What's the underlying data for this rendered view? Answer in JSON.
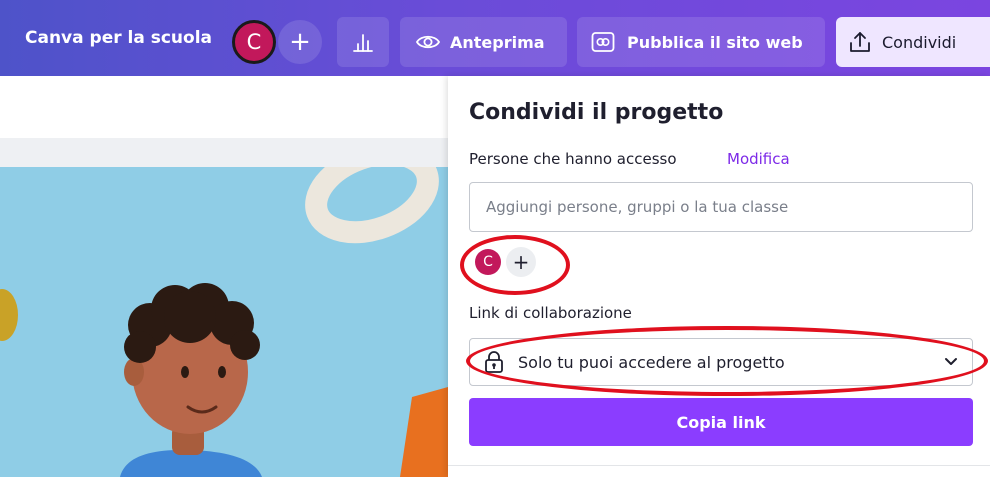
{
  "topbar": {
    "brand": "Canva per la scuola",
    "avatar_initial": "C",
    "add_symbol": "+",
    "preview_label": "Anteprima",
    "publish_label": "Pubblica il sito web",
    "share_label": "Condividi"
  },
  "share_panel": {
    "title": "Condividi il progetto",
    "access_label": "Persone che hanno accesso",
    "edit_link": "Modifica",
    "add_people_placeholder": "Aggiungi persone, gruppi o la tua classe",
    "member_initial": "C",
    "add_member_symbol": "+",
    "collab_link_label": "Link di collaborazione",
    "collab_link_value": "Solo tu puoi accedere al progetto",
    "copy_link_label": "Copia link"
  },
  "colors": {
    "topbar_start": "#4e53c9",
    "topbar_end": "#7b45e0",
    "accent": "#8b3dff",
    "avatar": "#c2185b",
    "annotation": "#e0101e"
  },
  "icons": [
    "insights-icon",
    "eye-icon",
    "publish-website-icon",
    "share-upload-icon",
    "lock-icon",
    "chevron-down-icon"
  ]
}
